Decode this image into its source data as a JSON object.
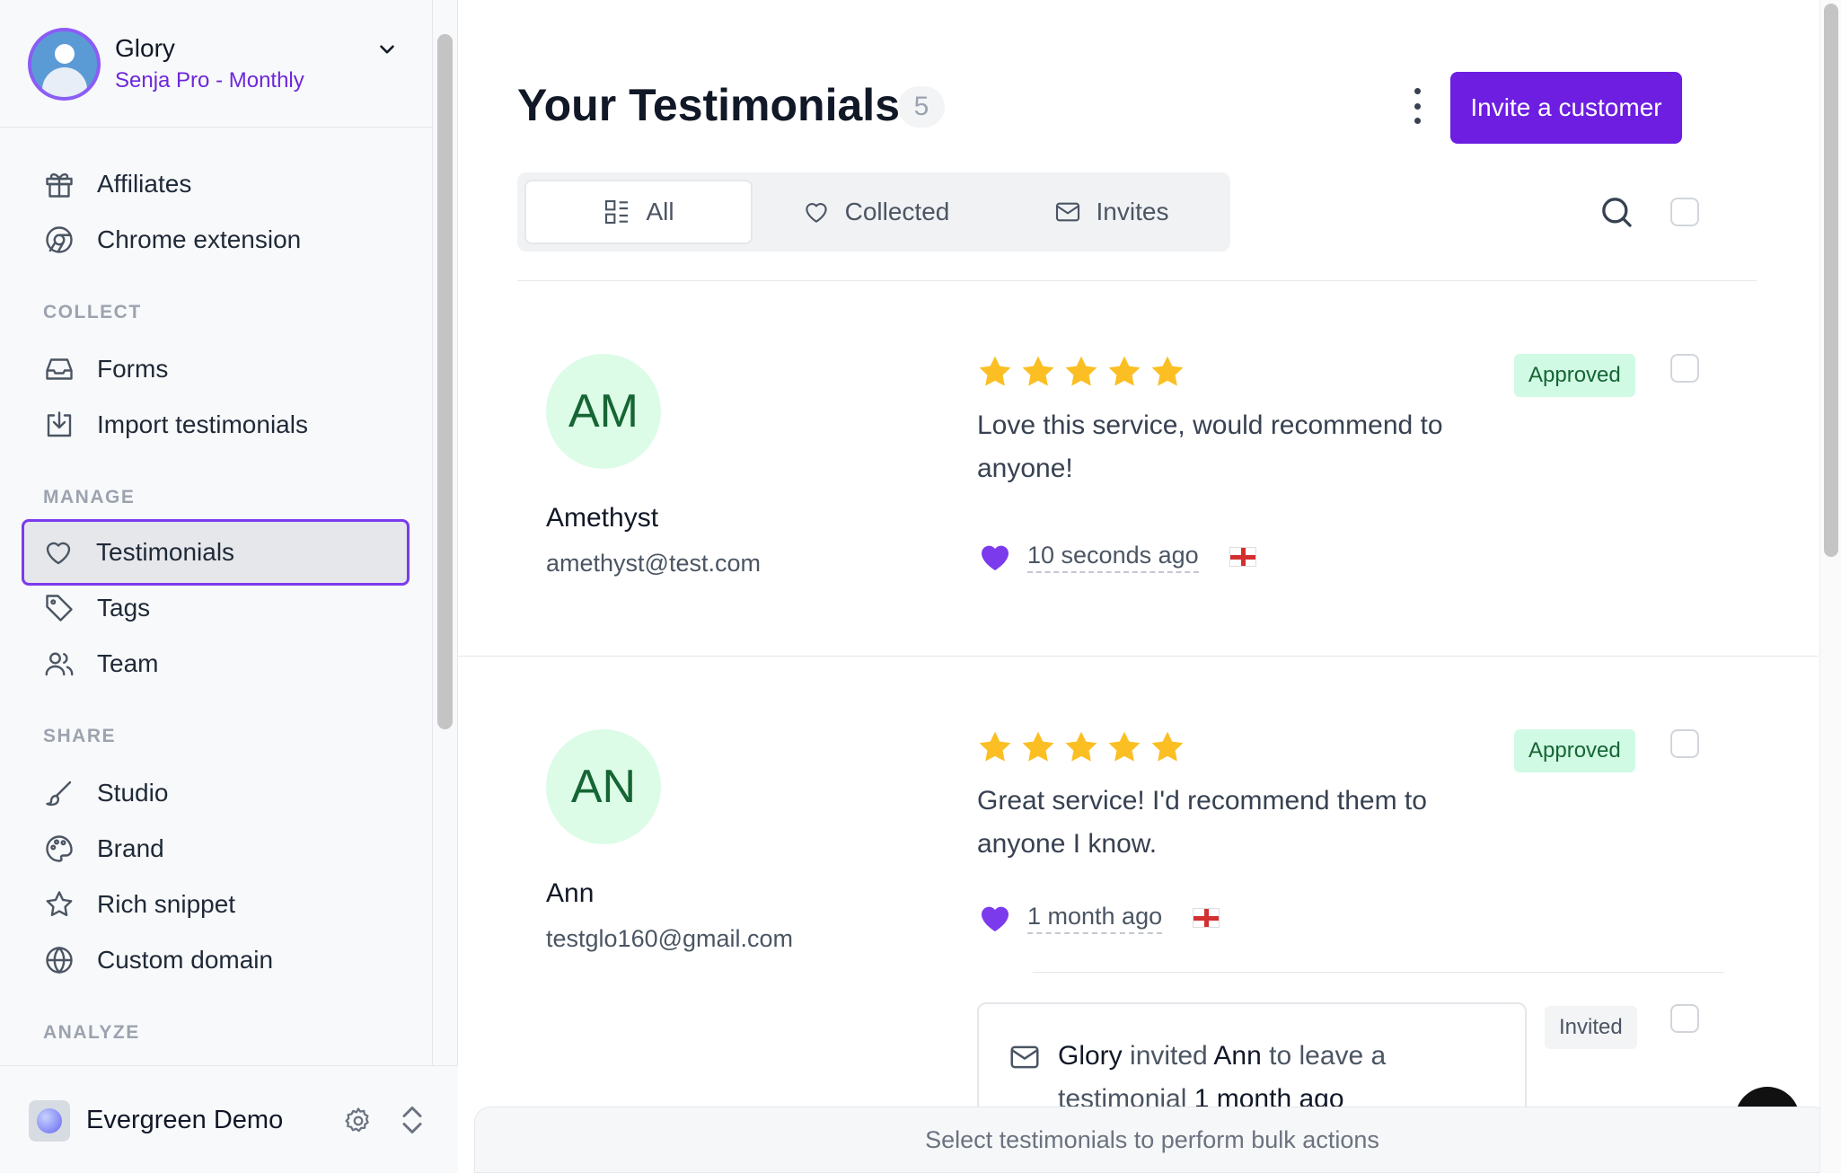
{
  "account": {
    "name": "Glory",
    "plan": "Senja Pro - Monthly"
  },
  "sidebar": {
    "top_items": [
      {
        "label": "Affiliates",
        "icon": "gift-icon"
      },
      {
        "label": "Chrome extension",
        "icon": "chrome-icon"
      }
    ],
    "sections": {
      "collect": "COLLECT",
      "manage": "MANAGE",
      "share": "SHARE",
      "analyze": "ANALYZE"
    },
    "collect_items": [
      {
        "label": "Forms",
        "icon": "inbox-icon"
      },
      {
        "label": "Import testimonials",
        "icon": "import-icon"
      }
    ],
    "manage_items": [
      {
        "label": "Testimonials",
        "icon": "heart-icon"
      },
      {
        "label": "Tags",
        "icon": "tag-icon"
      },
      {
        "label": "Team",
        "icon": "users-icon"
      }
    ],
    "share_items": [
      {
        "label": "Studio",
        "icon": "brush-icon"
      },
      {
        "label": "Brand",
        "icon": "palette-icon"
      },
      {
        "label": "Rich snippet",
        "icon": "star-icon"
      },
      {
        "label": "Custom domain",
        "icon": "globe-icon"
      }
    ]
  },
  "workspace": {
    "name": "Evergreen Demo"
  },
  "header": {
    "title": "Your Testimonials",
    "count": "5",
    "invite_button": "Invite a customer"
  },
  "tabs": [
    {
      "label": "All",
      "icon": "grid-list-icon",
      "active": true
    },
    {
      "label": "Collected",
      "icon": "heart-icon"
    },
    {
      "label": "Invites",
      "icon": "mail-icon"
    }
  ],
  "testimonials": [
    {
      "initials": "AM",
      "name": "Amethyst",
      "email": "amethyst@test.com",
      "rating": 5,
      "text": "Love this service, would recommend to anyone!",
      "time": "10 seconds ago",
      "status": "Approved"
    },
    {
      "initials": "AN",
      "name": "Ann",
      "email": "testglo160@gmail.com",
      "rating": 5,
      "text": "Great service! I'd recommend them to anyone I know.",
      "time": "1 month ago",
      "status": "Approved"
    }
  ],
  "invite": {
    "inviter": "Glory",
    "verb": " invited ",
    "invitee": "Ann",
    "rest": " to leave a testimonial ",
    "time": "1 month ago",
    "status": "Invited"
  },
  "bulk_bar": "Select testimonials to perform bulk actions",
  "colors": {
    "accent": "#6d1ee0",
    "approved_bg": "#d1fae5",
    "star": "#fbbf24"
  }
}
